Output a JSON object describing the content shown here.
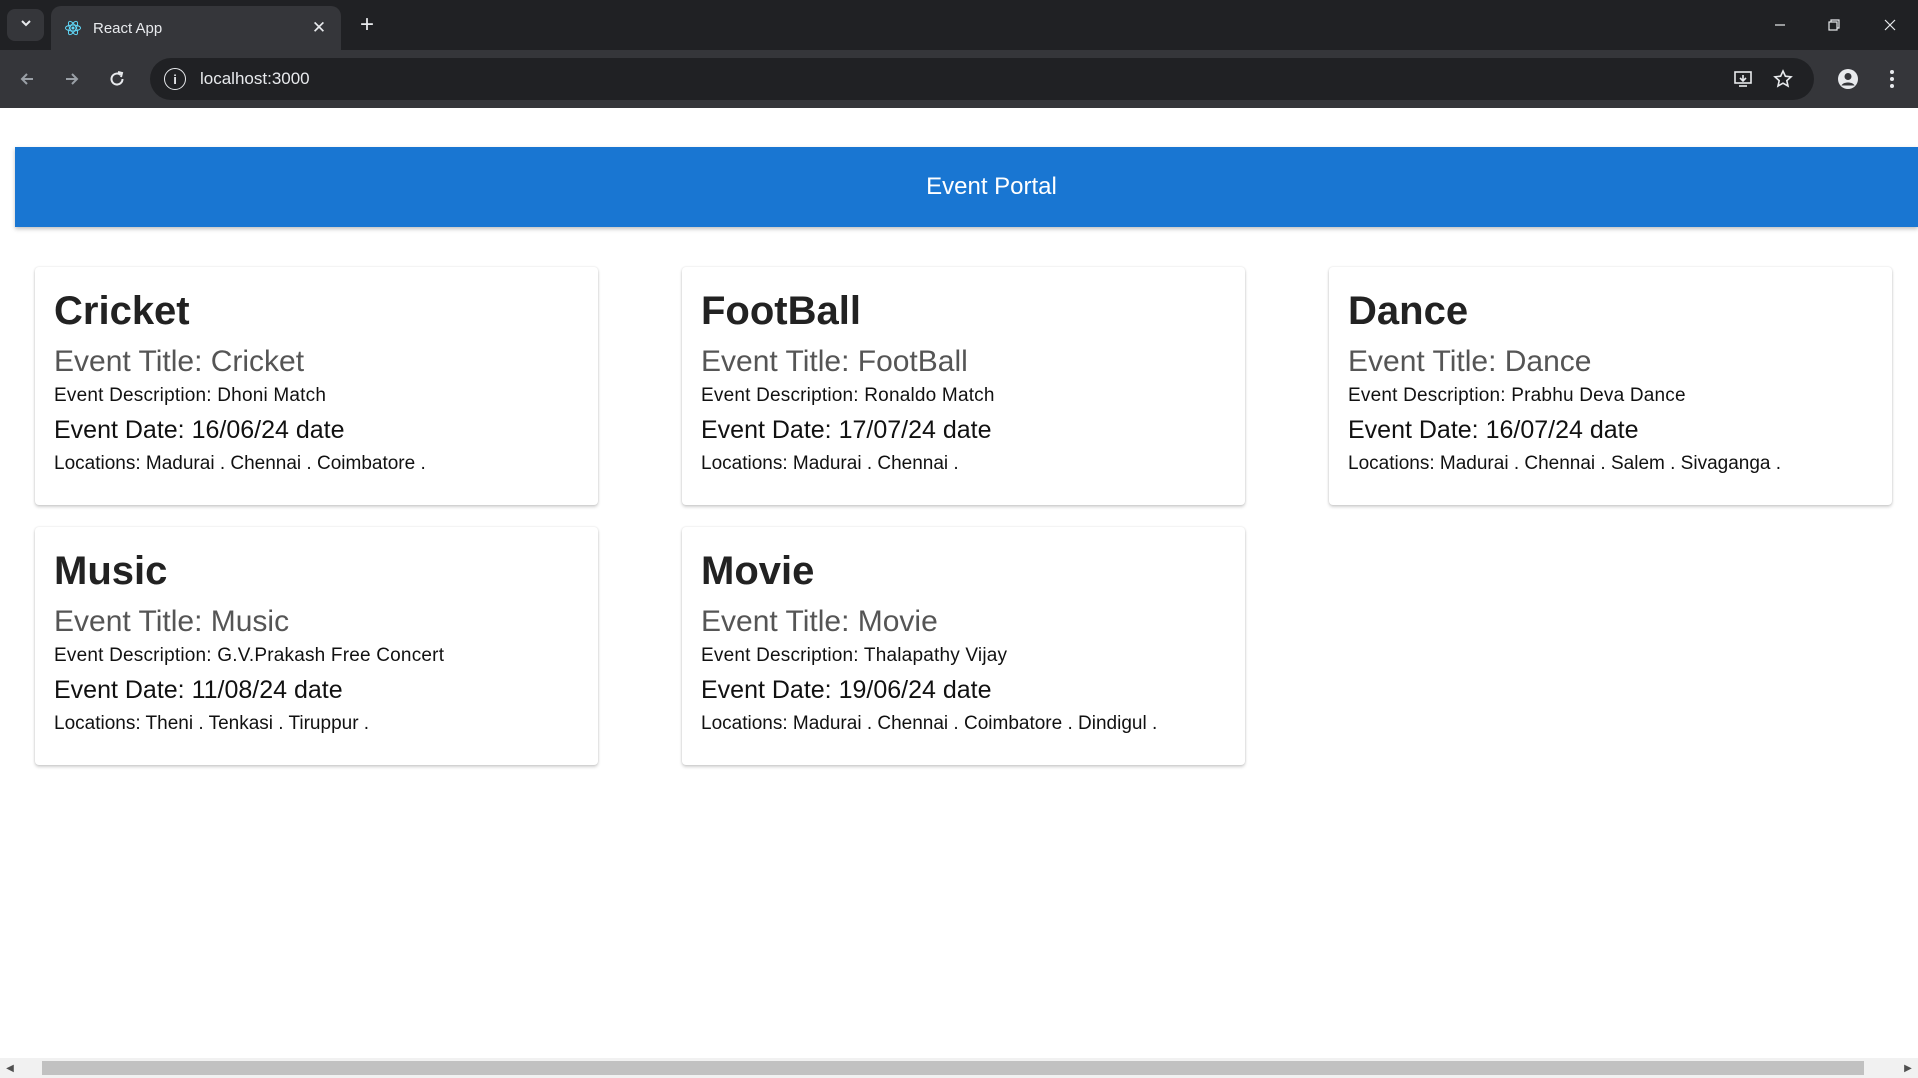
{
  "browser": {
    "tab_title": "React App",
    "url": "localhost:3000"
  },
  "app": {
    "header_title": "Event Portal"
  },
  "events": [
    {
      "heading": "Cricket",
      "title_line": "Event Title: Cricket",
      "description_line": "Event Description: Dhoni Match",
      "date_line": "Event Date: 16/06/24 date",
      "locations_line": "Locations: Madurai . Chennai . Coimbatore ."
    },
    {
      "heading": "FootBall",
      "title_line": "Event Title: FootBall",
      "description_line": "Event Description: Ronaldo Match",
      "date_line": "Event Date: 17/07/24 date",
      "locations_line": "Locations: Madurai . Chennai ."
    },
    {
      "heading": "Dance",
      "title_line": "Event Title: Dance",
      "description_line": "Event Description: Prabhu Deva Dance",
      "date_line": "Event Date: 16/07/24 date",
      "locations_line": "Locations: Madurai . Chennai . Salem . Sivaganga ."
    },
    {
      "heading": "Music",
      "title_line": "Event Title: Music",
      "description_line": "Event Description: G.V.Prakash Free Concert",
      "date_line": "Event Date: 11/08/24 date",
      "locations_line": "Locations: Theni . Tenkasi . Tiruppur ."
    },
    {
      "heading": "Movie",
      "title_line": "Event Title: Movie",
      "description_line": "Event Description: Thalapathy Vijay",
      "date_line": "Event Date: 19/06/24 date",
      "locations_line": "Locations: Madurai . Chennai . Coimbatore . Dindigul ."
    }
  ]
}
